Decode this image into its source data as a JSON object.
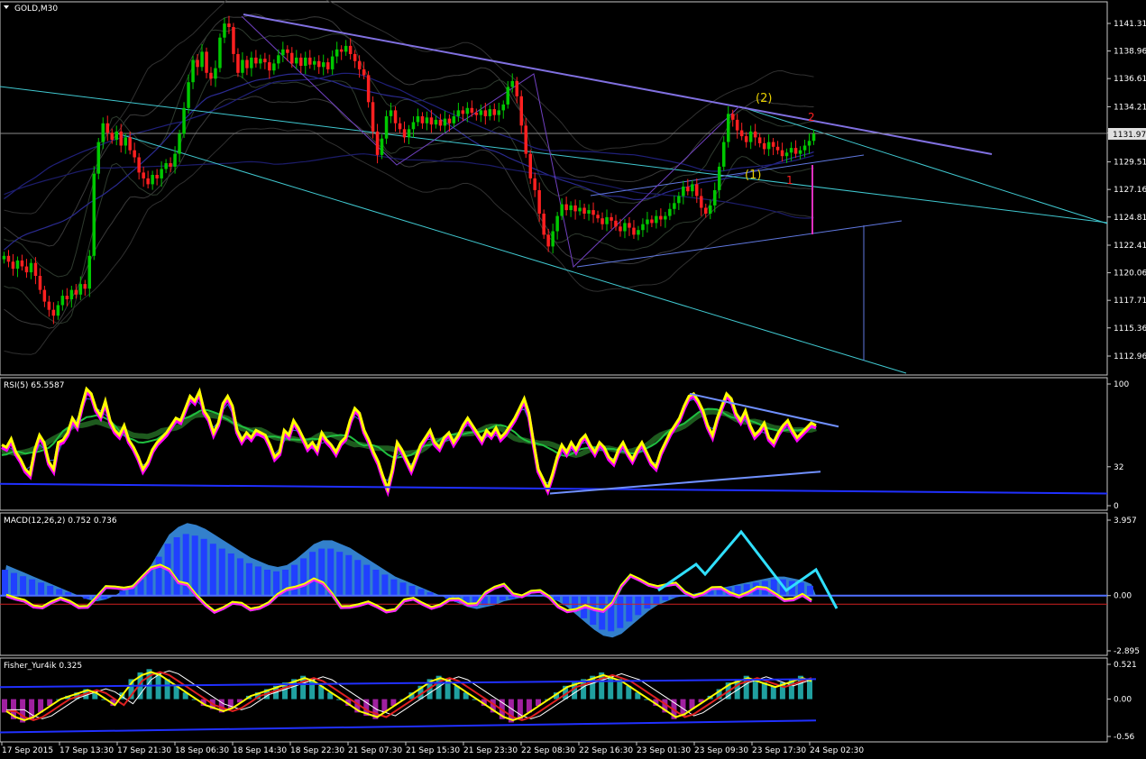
{
  "colors": {
    "background": "#000000",
    "grid_border": "#c8c8c8",
    "candle_up": "#00c800",
    "candle_down": "#ff2020",
    "trendline": "#8070e0",
    "channel": "#40c8d0",
    "rsi_main": "#ffff00",
    "rsi_shadow": "#ff00ff",
    "macd_hist": "#2040ff",
    "macd_cloud": "#40a0ff",
    "fisher_pos": "#20a0a0",
    "fisher_neg": "#a020a0",
    "arrow": "#30e0ff"
  },
  "chart_data": [
    {
      "type": "candlestick",
      "title": "GOLD,M30",
      "ylim": [
        1111.5,
        1143.0
      ],
      "y_ticks": [
        "1141.31",
        "1138.96",
        "1136.61",
        "1134.21",
        "1131.97",
        "1129.51",
        "1127.16",
        "1124.81",
        "1122.41",
        "1120.06",
        "1117.71",
        "1115.36",
        "1112.96"
      ],
      "y_tick_values": [
        1141.31,
        1138.96,
        1136.61,
        1134.21,
        1131.97,
        1129.51,
        1127.16,
        1124.81,
        1122.41,
        1120.06,
        1117.71,
        1115.36,
        1112.96
      ],
      "current_price": "1131.97",
      "annotations": [
        "(2)",
        "(1)",
        "2",
        "1"
      ],
      "close": [
        1121.5,
        1121.0,
        1120.4,
        1121.1,
        1120.6,
        1120.1,
        1120.9,
        1119.8,
        1118.6,
        1117.6,
        1116.9,
        1116.4,
        1117.3,
        1118.1,
        1117.8,
        1118.6,
        1118.2,
        1119.1,
        1118.7,
        1121.5,
        1128.5,
        1131.2,
        1132.8,
        1132.0,
        1131.4,
        1132.1,
        1130.9,
        1131.6,
        1130.5,
        1129.9,
        1128.6,
        1128.1,
        1127.6,
        1128.4,
        1128.1,
        1128.9,
        1129.4,
        1129.1,
        1130.2,
        1131.9,
        1134.1,
        1136.3,
        1138.2,
        1137.6,
        1138.9,
        1137.1,
        1136.6,
        1137.5,
        1140.1,
        1141.3,
        1141.0,
        1138.7,
        1137.1,
        1138.2,
        1137.5,
        1138.4,
        1137.9,
        1138.3,
        1138.0,
        1137.3,
        1137.9,
        1138.6,
        1139.1,
        1138.8,
        1137.9,
        1138.4,
        1137.7,
        1138.4,
        1137.8,
        1138.1,
        1137.6,
        1138.0,
        1137.4,
        1138.5,
        1139.1,
        1138.9,
        1139.4,
        1138.7,
        1138.1,
        1137.4,
        1136.9,
        1134.6,
        1132.1,
        1130.1,
        1131.5,
        1133.4,
        1133.9,
        1132.8,
        1132.3,
        1131.6,
        1132.3,
        1132.9,
        1133.4,
        1132.8,
        1133.3,
        1132.7,
        1133.1,
        1132.6,
        1133.2,
        1132.8,
        1133.4,
        1133.9,
        1133.6,
        1134.1,
        1133.7,
        1133.5,
        1133.9,
        1133.4,
        1134.0,
        1133.5,
        1133.9,
        1134.4,
        1135.9,
        1136.4,
        1135.1,
        1132.6,
        1130.2,
        1128.1,
        1127.1,
        1125.1,
        1123.3,
        1122.3,
        1123.6,
        1124.9,
        1125.9,
        1125.4,
        1125.8,
        1125.3,
        1125.6,
        1125.1,
        1125.4,
        1125.0,
        1124.7,
        1124.2,
        1124.8,
        1124.5,
        1124.0,
        1123.6,
        1124.3,
        1123.9,
        1123.3,
        1123.7,
        1124.2,
        1124.6,
        1124.3,
        1124.9,
        1124.6,
        1124.9,
        1125.5,
        1126.0,
        1126.6,
        1127.4,
        1127.0,
        1127.6,
        1126.6,
        1125.6,
        1125.1,
        1125.8,
        1127.1,
        1129.1,
        1131.2,
        1133.6,
        1133.1,
        1132.2,
        1131.7,
        1131.2,
        1132.1,
        1131.6,
        1131.1,
        1130.6,
        1131.2,
        1130.8,
        1130.5,
        1130.0,
        1130.3,
        1130.7,
        1130.2,
        1130.5,
        1130.9,
        1131.3,
        1131.9
      ],
      "open": [
        1121.2,
        1121.5,
        1121.0,
        1120.4,
        1121.1,
        1120.6,
        1120.1,
        1120.9,
        1119.8,
        1118.6,
        1117.6,
        1116.9,
        1116.4,
        1117.3,
        1118.1,
        1117.8,
        1118.6,
        1118.2,
        1119.1,
        1118.7,
        1121.5,
        1128.5,
        1131.2,
        1132.8,
        1132.0,
        1131.4,
        1132.1,
        1130.9,
        1131.6,
        1130.5,
        1129.9,
        1128.6,
        1128.1,
        1127.6,
        1128.4,
        1128.1,
        1128.9,
        1129.4,
        1129.1,
        1130.2,
        1131.9,
        1134.1,
        1136.3,
        1138.2,
        1137.6,
        1138.9,
        1137.1,
        1136.6,
        1137.5,
        1140.1,
        1141.3,
        1141.0,
        1138.7,
        1137.1,
        1138.2,
        1137.5,
        1138.4,
        1137.9,
        1138.3,
        1138.0,
        1137.3,
        1137.9,
        1138.6,
        1139.1,
        1138.8,
        1137.9,
        1138.4,
        1137.7,
        1138.4,
        1137.8,
        1138.1,
        1137.6,
        1138.0,
        1137.4,
        1138.5,
        1139.1,
        1138.9,
        1139.4,
        1138.7,
        1138.1,
        1137.4,
        1136.9,
        1134.6,
        1132.1,
        1130.1,
        1131.5,
        1133.4,
        1133.9,
        1132.8,
        1132.3,
        1131.6,
        1132.3,
        1132.9,
        1133.4,
        1132.8,
        1133.3,
        1132.7,
        1133.1,
        1132.6,
        1133.2,
        1132.8,
        1133.4,
        1133.9,
        1133.6,
        1134.1,
        1133.7,
        1133.5,
        1133.9,
        1133.4,
        1134.0,
        1133.5,
        1133.9,
        1134.4,
        1135.9,
        1136.4,
        1135.1,
        1132.6,
        1130.2,
        1128.1,
        1127.1,
        1125.1,
        1123.3,
        1122.3,
        1123.6,
        1124.9,
        1125.9,
        1125.4,
        1125.8,
        1125.3,
        1125.6,
        1125.1,
        1125.4,
        1125.0,
        1124.7,
        1124.2,
        1124.8,
        1124.5,
        1124.0,
        1123.6,
        1124.3,
        1123.9,
        1123.3,
        1123.7,
        1124.2,
        1124.6,
        1124.3,
        1124.9,
        1124.6,
        1124.9,
        1125.5,
        1126.0,
        1126.6,
        1127.4,
        1127.0,
        1127.6,
        1126.6,
        1125.6,
        1125.1,
        1125.8,
        1127.1,
        1129.1,
        1131.2,
        1133.6,
        1133.1,
        1132.2,
        1131.7,
        1131.2,
        1132.1,
        1131.6,
        1131.1,
        1130.6,
        1131.2,
        1130.8,
        1130.5,
        1130.0,
        1130.3,
        1130.7,
        1130.2,
        1130.5,
        1130.9,
        1131.3
      ]
    },
    {
      "type": "line",
      "title": "RSI(5) 65.5587",
      "ylim": [
        0,
        100
      ],
      "y_ticks": [
        "100",
        "32",
        "0"
      ],
      "y_tick_values": [
        100,
        32,
        0
      ],
      "series": [
        {
          "values": [
            50,
            48,
            55,
            44,
            38,
            30,
            26,
            46,
            58,
            52,
            36,
            30,
            52,
            54,
            60,
            72,
            66,
            82,
            96,
            92,
            80,
            74,
            86,
            70,
            62,
            58,
            66,
            54,
            48,
            40,
            30,
            36,
            46,
            52,
            56,
            60,
            66,
            72,
            70,
            80,
            90,
            86,
            94,
            78,
            72,
            60,
            68,
            84,
            90,
            82,
            62,
            54,
            60,
            56,
            62,
            60,
            58,
            50,
            40,
            44,
            62,
            58,
            70,
            64,
            56,
            48,
            52,
            46,
            60,
            54,
            50,
            44,
            52,
            56,
            70,
            80,
            76,
            62,
            54,
            44,
            36,
            24,
            14,
            30,
            52,
            46,
            38,
            30,
            40,
            50,
            56,
            62,
            52,
            48,
            56,
            60,
            52,
            58,
            66,
            72,
            66,
            60,
            54,
            62,
            58,
            64,
            56,
            60,
            66,
            72,
            80,
            88,
            76,
            52,
            30,
            22,
            14,
            26,
            40,
            50,
            44,
            52,
            46,
            54,
            58,
            50,
            44,
            52,
            48,
            40,
            36,
            46,
            52,
            44,
            38,
            46,
            52,
            44,
            36,
            32,
            44,
            52,
            60,
            66,
            72,
            82,
            90,
            92,
            86,
            78,
            66,
            58,
            72,
            82,
            92,
            88,
            76,
            70,
            78,
            66,
            58,
            62,
            68,
            56,
            52,
            60,
            66,
            70,
            62,
            56,
            60,
            64,
            68,
            66
          ]
        }
      ]
    },
    {
      "type": "bar",
      "title": "MACD(12,26,2) 0.752 0.736",
      "ylim": [
        -2.895,
        3.957
      ],
      "y_ticks": [
        "3.957",
        "0.00",
        "-2.895"
      ],
      "y_tick_values": [
        3.957,
        0.0,
        -2.895
      ],
      "values": [
        1.6,
        1.4,
        1.2,
        1.0,
        0.8,
        0.6,
        0.4,
        0.2,
        0.0,
        -0.2,
        -0.3,
        -0.2,
        0.0,
        0.3,
        0.6,
        1.0,
        1.6,
        2.4,
        3.2,
        3.6,
        3.8,
        3.7,
        3.5,
        3.2,
        2.9,
        2.6,
        2.3,
        2.0,
        1.8,
        1.6,
        1.5,
        1.6,
        1.9,
        2.3,
        2.7,
        2.9,
        2.9,
        2.7,
        2.5,
        2.2,
        1.9,
        1.6,
        1.3,
        1.0,
        0.8,
        0.6,
        0.4,
        0.2,
        0.0,
        -0.2,
        -0.4,
        -0.6,
        -0.7,
        -0.6,
        -0.5,
        -0.3,
        -0.2,
        -0.1,
        0.0,
        0.0,
        -0.1,
        -0.3,
        -0.6,
        -1.0,
        -1.4,
        -1.8,
        -2.1,
        -2.2,
        -2.0,
        -1.6,
        -1.2,
        -0.8,
        -0.5,
        -0.3,
        -0.1,
        0.0,
        0.1,
        0.2,
        0.3,
        0.4,
        0.5,
        0.6,
        0.7,
        0.8,
        0.9,
        1.0,
        1.0,
        0.9,
        0.8,
        0.6
      ]
    },
    {
      "type": "bar",
      "title": "Fisher_Yur4ik 0.325",
      "ylim": [
        -0.56,
        0.521
      ],
      "y_ticks": [
        "0.521",
        "0.00",
        "-0.56"
      ],
      "y_tick_values": [
        0.521,
        0.0,
        -0.56
      ],
      "values": [
        -0.2,
        -0.3,
        -0.35,
        -0.3,
        -0.2,
        -0.1,
        0.0,
        0.05,
        0.1,
        0.15,
        0.1,
        0.0,
        -0.1,
        0.1,
        0.3,
        0.4,
        0.45,
        0.4,
        0.3,
        0.2,
        0.1,
        0.0,
        -0.1,
        -0.15,
        -0.2,
        -0.15,
        -0.05,
        0.05,
        0.1,
        0.15,
        0.2,
        0.25,
        0.3,
        0.35,
        0.3,
        0.2,
        0.1,
        0.0,
        -0.1,
        -0.2,
        -0.25,
        -0.3,
        -0.2,
        -0.1,
        0.0,
        0.1,
        0.2,
        0.3,
        0.35,
        0.3,
        0.2,
        0.1,
        0.0,
        -0.1,
        -0.2,
        -0.3,
        -0.35,
        -0.3,
        -0.2,
        -0.1,
        0.0,
        0.1,
        0.2,
        0.25,
        0.3,
        0.35,
        0.4,
        0.35,
        0.3,
        0.2,
        0.1,
        0.0,
        -0.1,
        -0.2,
        -0.3,
        -0.25,
        -0.15,
        -0.05,
        0.05,
        0.15,
        0.25,
        0.3,
        0.35,
        0.3,
        0.25,
        0.2,
        0.25,
        0.3,
        0.35,
        0.3
      ]
    }
  ],
  "x_ticks": [
    "17 Sep 2015",
    "17 Sep 13:30",
    "17 Sep 21:30",
    "18 Sep 06:30",
    "18 Sep 14:30",
    "18 Sep 22:30",
    "21 Sep 07:30",
    "21 Sep 15:30",
    "21 Sep 23:30",
    "22 Sep 08:30",
    "22 Sep 16:30",
    "23 Sep 01:30",
    "23 Sep 09:30",
    "23 Sep 17:30",
    "24 Sep 02:30"
  ]
}
